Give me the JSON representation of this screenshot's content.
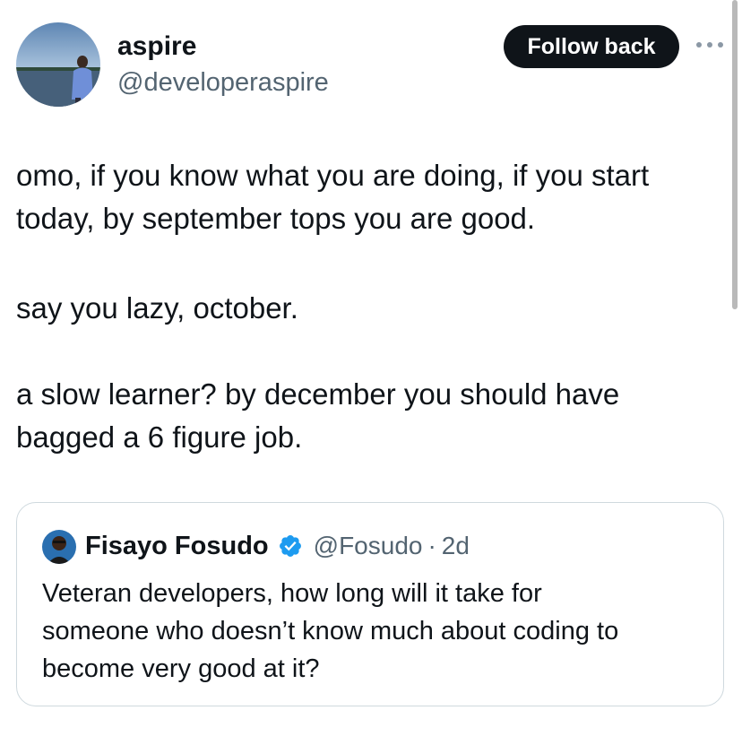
{
  "author": {
    "display_name": "aspire",
    "handle": "@developeraspire"
  },
  "actions": {
    "follow_label": "Follow back",
    "more_icon": "more-horizontal-icon"
  },
  "tweet": {
    "paragraphs": [
      [
        "omo, if you know what you are doing, if you start",
        "today, by september tops you are good."
      ],
      [
        "say you lazy, october."
      ],
      [
        "a slow learner? by december you should have",
        "bagged a 6 figure job."
      ]
    ]
  },
  "quoted_tweet": {
    "display_name": "Fisayo Fosudo",
    "verified_icon": "verified-badge-icon",
    "handle": "@Fosudo",
    "separator": "·",
    "time": "2d",
    "lines": [
      "Veteran developers, how long will it take for",
      "someone who doesn’t know much about coding to",
      "become very good at it?"
    ]
  },
  "colors": {
    "text_primary": "#0f1419",
    "text_secondary": "#536471",
    "button_bg": "#0f1419",
    "verified_blue": "#1d9bf0",
    "card_border": "#cfd9de"
  }
}
